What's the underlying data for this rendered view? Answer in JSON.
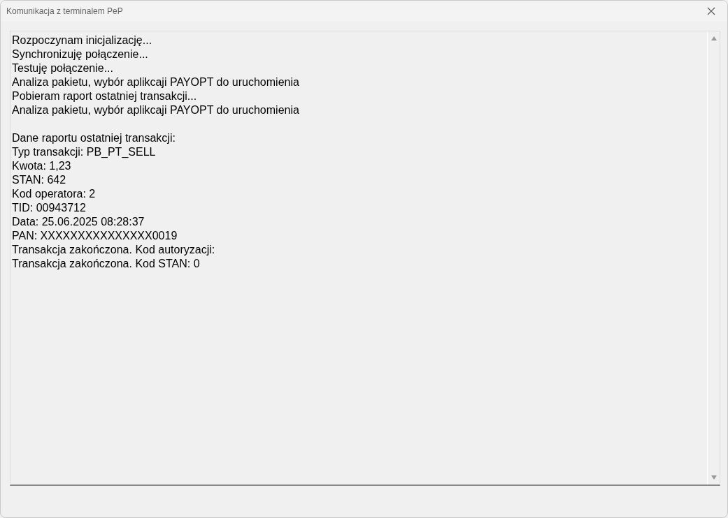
{
  "window": {
    "title": "Komunikacja z terminalem PeP"
  },
  "log": {
    "blocks": [
      [
        "Rozpoczynam inicjalizację...",
        "Synchronizuję połączenie...",
        "Testuję połączenie...",
        "Analiza pakietu, wybór aplikcaji PAYOPT do uruchomienia",
        "Pobieram raport ostatniej transakcji...",
        "Analiza pakietu, wybór aplikcaji PAYOPT do uruchomienia"
      ],
      [
        "Dane raportu ostatniej transakcji:",
        "Typ transakcji: PB_PT_SELL",
        "Kwota: 1,23",
        "STAN: 642",
        "Kod operatora: 2",
        "TID: 00943712",
        "Data: 25.06.2025 08:28:37",
        "PAN: XXXXXXXXXXXXXXX0019",
        "Transakcja zakończona. Kod autoryzacji:",
        "Transakcja zakończona. Kod STAN: 0"
      ]
    ]
  }
}
